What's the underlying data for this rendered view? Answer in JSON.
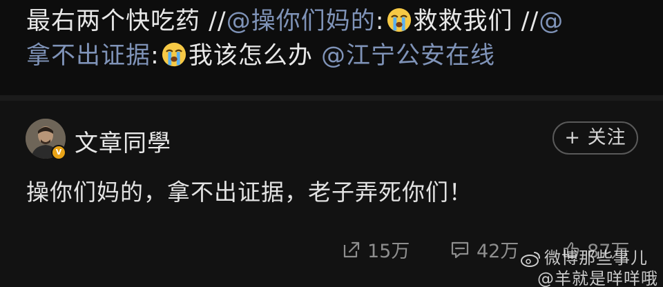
{
  "repost_chain": {
    "line1": {
      "text_a": "最右两个快吃药 //",
      "mention_a": "@操你们妈的",
      "colon_a": ":",
      "emoji_a": "crying-face-emoji",
      "text_b": "救救我们 //",
      "mention_b_part": "@"
    },
    "line2": {
      "mention_b": "拿不出证据",
      "colon_b": ":",
      "emoji_b": "crying-face-emoji",
      "text_c": "我该怎么办 ",
      "mention_c": "@江宁公安在线"
    }
  },
  "post": {
    "username": "文章同學",
    "verified_badge": "V",
    "follow_label": "+ 关注",
    "text": "操你们妈的，拿不出证据，老子弄死你们！",
    "stats": {
      "share_count": "15万",
      "comment_count": "42万",
      "like_count": "87万"
    }
  },
  "watermark": {
    "line1": "微博那些事儿",
    "line2": "@羊就是咩咩哦"
  },
  "colors": {
    "background": "#0d0d0d",
    "post_background": "#121212",
    "link": "#7f93b8",
    "text": "#e8e8e8",
    "muted": "#8e8e8e",
    "badge": "#e8a317"
  },
  "icons": {
    "share": "share-icon",
    "comment": "comment-icon",
    "like": "thumbs-up-icon",
    "watermark_logo": "weibo-logo-icon"
  }
}
